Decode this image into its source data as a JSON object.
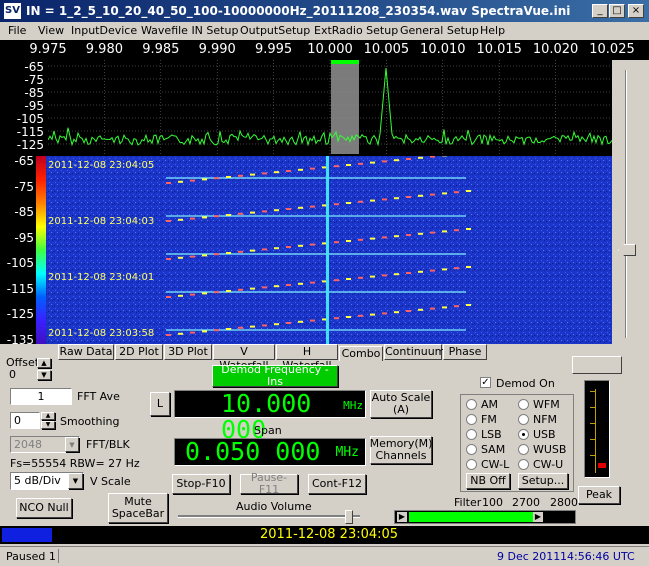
{
  "titlebar": {
    "title": "IN = 1_2_5_10_20_40_50_100-10000000Hz_20111208_230354.wav    SpectraVue.ini",
    "icon": "SV",
    "min": "_",
    "max": "□",
    "close": "×"
  },
  "menu": [
    "File",
    "View",
    "InputDevice",
    "Wavefile IN Setup",
    "OutputSetup",
    "ExtRadio Setup",
    "General Setup",
    "Help"
  ],
  "freq_ticks": [
    "9.975",
    "9.980",
    "9.985",
    "9.990",
    "9.995",
    "10.000",
    "10.005",
    "10.010",
    "10.015",
    "10.020",
    "10.025"
  ],
  "spectrum_y": [
    "-65",
    "-75",
    "-85",
    "-95",
    "-105",
    "-115",
    "-125"
  ],
  "waterfall_y": [
    "-65",
    "-75",
    "-85",
    "-95",
    "-105",
    "-115",
    "-125",
    "-135"
  ],
  "timestamps": [
    "2011-12-08 23:04:05",
    "2011-12-08 23:04:03",
    "2011-12-08 23:04:01",
    "2011-12-08 23:03:58"
  ],
  "tabs": [
    "Raw Data",
    "2D Plot",
    "3D Plot",
    "V Waterfall",
    "H Waterfall",
    "Combo",
    "Continuum",
    "Phase"
  ],
  "offset": {
    "label": "Offset",
    "value": "0"
  },
  "fft_ave": {
    "value": "1",
    "label": "FFT Ave"
  },
  "smoothing": {
    "value": "0",
    "label": "Smoothing"
  },
  "fft_blk": {
    "value": "2048",
    "label": "FFT/BLK"
  },
  "fs_info": "Fs=55554 RBW= 27 Hz",
  "vscale": {
    "value": "5 dB/Div",
    "label": "V Scale"
  },
  "nco_null": "NCO Null",
  "mute": "Mute SpaceBar",
  "demod_freq_btn": "Demod Frequency - Ins",
  "l_btn": "L",
  "demod_freq_value": "10.000 000",
  "demod_unit": "MHz",
  "auto_scale": "Auto Scale (A)",
  "span_label": "Span",
  "span_value": "0.050 000",
  "span_unit": "MHz",
  "memory": "Memory(M) Channels",
  "stop": "Stop-F10",
  "pause": "Pause-F11",
  "cont": "Cont-F12",
  "audio_volume": "Audio Volume",
  "demod_on": "Demod On",
  "modes": [
    {
      "label": "AM",
      "on": false
    },
    {
      "label": "WFM",
      "on": false
    },
    {
      "label": "FM",
      "on": false
    },
    {
      "label": "NFM",
      "on": false
    },
    {
      "label": "LSB",
      "on": false
    },
    {
      "label": "USB",
      "on": true
    },
    {
      "label": "SAM",
      "on": false
    },
    {
      "label": "WUSB",
      "on": false
    },
    {
      "label": "CW-L",
      "on": false
    },
    {
      "label": "CW-U",
      "on": false
    }
  ],
  "nb_off": "NB Off",
  "setup": "Setup...",
  "filter": {
    "label": "Filter",
    "low": "100",
    "mid": "2700",
    "high": "2800"
  },
  "peak": "Peak",
  "time_strip": "2011-12-08 23:04:05",
  "status": {
    "left": "Paused 1",
    "date": "9 Dec 2011",
    "time": "14:56:46 UTC"
  },
  "colors": {
    "title": "#0a246a",
    "lcd": "#00ff00",
    "spectrum_trace": "#33ff33",
    "waterfall": "#1833c8",
    "demod_btn": "#00cc00"
  }
}
